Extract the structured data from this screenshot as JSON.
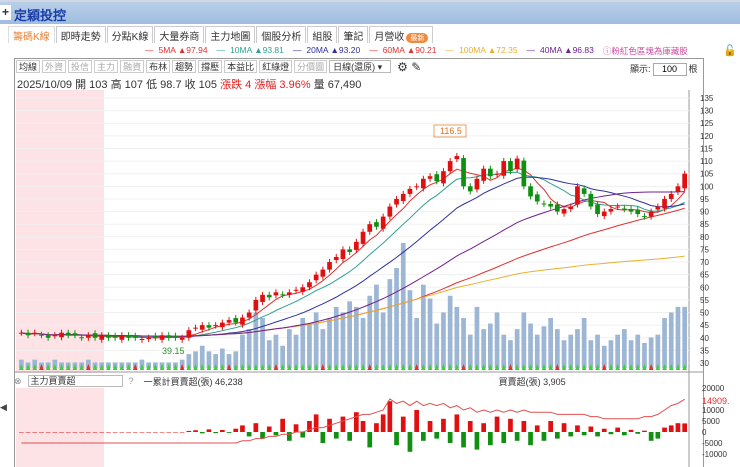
{
  "window": {
    "title": "定穎投控",
    "plus": "+"
  },
  "tabs": [
    {
      "label": "籌碼K線",
      "active": true
    },
    {
      "label": "即時走勢"
    },
    {
      "label": "分點K線"
    },
    {
      "label": "大量券商"
    },
    {
      "label": "主力地圖"
    },
    {
      "label": "個股分析"
    },
    {
      "label": "組股"
    },
    {
      "label": "筆記"
    },
    {
      "label": "月營收",
      "badge": "最新"
    }
  ],
  "legend": [
    {
      "label": "5MA",
      "value": "▲97.94",
      "color": "#e03030"
    },
    {
      "label": "10MA",
      "value": "▲93.81",
      "color": "#30a090"
    },
    {
      "label": "20MA",
      "value": "▲93.20",
      "color": "#3030a0"
    },
    {
      "label": "60MA",
      "value": "▲90.21",
      "color": "#e03030"
    },
    {
      "label": "100MA",
      "value": "▲72.35",
      "color": "#e8b030"
    },
    {
      "label": "40MA",
      "value": "▲96.83",
      "color": "#702090"
    }
  ],
  "legend_note": "ⓘ粉紅色區塊為庫藏股",
  "toolbar": [
    {
      "label": "均線"
    },
    {
      "label": "外資",
      "disabled": true
    },
    {
      "label": "投信",
      "disabled": true
    },
    {
      "label": "主力",
      "disabled": true
    },
    {
      "label": "融資",
      "disabled": true
    },
    {
      "label": "布林"
    },
    {
      "label": "趨勢"
    },
    {
      "label": "撐壓"
    },
    {
      "label": "本益比"
    },
    {
      "label": "紅綠燈"
    },
    {
      "label": "分價圖",
      "disabled": true
    }
  ],
  "period_select": "日線(還原)",
  "display": {
    "label": "顯示:",
    "value": "100",
    "unit": "根"
  },
  "info": {
    "date": "2025/10/09",
    "open": "開 103",
    "high": "高 107",
    "low": "低 98.7",
    "close": "收 105",
    "change": "漲跌 4",
    "pct": "漲幅 3.96%",
    "volume": "量 67,490"
  },
  "chart_data": {
    "type": "candlestick",
    "price_ticks": [
      135,
      130,
      125,
      120,
      115,
      110,
      105,
      100,
      95,
      90,
      85,
      80,
      75,
      70,
      65,
      60,
      55,
      50,
      45,
      40,
      35,
      30
    ],
    "ylim": [
      30,
      135
    ],
    "annotations": {
      "high": "116.5",
      "low": "39.15"
    },
    "closes": [
      42,
      41,
      42,
      41,
      40,
      41,
      42,
      41,
      41,
      40,
      41,
      40,
      41,
      40,
      40,
      41,
      40,
      40,
      39.5,
      40,
      40,
      41,
      40,
      40,
      40,
      43,
      44,
      45,
      44,
      45,
      46,
      47,
      46,
      48,
      50,
      55,
      57,
      56,
      58,
      57,
      58,
      59,
      60,
      62,
      65,
      67,
      70,
      72,
      75,
      74,
      78,
      82,
      85,
      84,
      88,
      92,
      95,
      97,
      99,
      100,
      103,
      104,
      102,
      106,
      110,
      112,
      100,
      98,
      103,
      107,
      104,
      105,
      110,
      106,
      111,
      100,
      96,
      94,
      93,
      92,
      90,
      91,
      92,
      100,
      97,
      92,
      89,
      90,
      91,
      92,
      91,
      90,
      89,
      88,
      90,
      92,
      95,
      97,
      100,
      105
    ],
    "volumes": [
      3,
      2,
      3,
      2,
      2,
      3,
      2,
      2,
      2,
      2,
      3,
      2,
      2,
      2,
      2,
      2,
      2,
      2,
      3,
      2,
      2,
      2,
      2,
      2,
      3,
      5,
      6,
      8,
      6,
      5,
      7,
      5,
      6,
      12,
      14,
      20,
      18,
      10,
      12,
      8,
      14,
      12,
      18,
      16,
      20,
      14,
      18,
      22,
      20,
      24,
      22,
      18,
      26,
      30,
      20,
      32,
      36,
      45,
      28,
      18,
      30,
      25,
      16,
      20,
      26,
      22,
      18,
      12,
      22,
      14,
      16,
      20,
      12,
      10,
      14,
      20,
      16,
      12,
      15,
      18,
      14,
      10,
      12,
      14,
      18,
      10,
      12,
      8,
      10,
      12,
      14,
      10,
      12,
      9,
      11,
      12,
      18,
      20,
      22,
      22
    ],
    "indicator": {
      "name": "主力買賣超",
      "cumulative_label": "一累計買賣超(張) 46,238",
      "daily_label": "買賣超(張) 3,905",
      "last_value": "14909.",
      "ticks": [
        20000,
        10000,
        5000,
        0,
        -5000,
        -10000
      ],
      "values": [
        0,
        0,
        0,
        0,
        0,
        0,
        0,
        0,
        0,
        0,
        0,
        0,
        0,
        0,
        0,
        0,
        0,
        0,
        0,
        0,
        0,
        0,
        0,
        0,
        0,
        500,
        800,
        -600,
        1200,
        -500,
        900,
        -400,
        1500,
        3000,
        -2000,
        4000,
        -3000,
        2500,
        -1500,
        6000,
        -4000,
        3500,
        -2500,
        5000,
        8000,
        -5000,
        6000,
        -3000,
        7000,
        -4000,
        9000,
        5000,
        -7000,
        4000,
        8000,
        14000,
        -6000,
        7000,
        -9000,
        10000,
        -4000,
        5000,
        -3000,
        6000,
        -5000,
        8000,
        -7000,
        5000,
        -8000,
        4000,
        -6000,
        7000,
        -5000,
        6000,
        -4000,
        5000,
        -6000,
        3000,
        -4000,
        5000,
        -3000,
        4000,
        -2000,
        3000,
        -1500,
        2500,
        -2000,
        1500,
        -1000,
        2000,
        -1500,
        1000,
        -800,
        600,
        -4000,
        -3000,
        2000,
        3000,
        4000,
        3905
      ],
      "cum_line": [
        -5000,
        -5000,
        -5000,
        -5000,
        -5000,
        -5000,
        -5000,
        -5000,
        -5000,
        -5000,
        -5000,
        -5000,
        -5000,
        -5000,
        -5000,
        -5000,
        -5000,
        -5000,
        -5000,
        -5000,
        -5000,
        -5000,
        -5000,
        -5000,
        -5000,
        -5000,
        -5000,
        -5000,
        -5000,
        -5000,
        -5000,
        -5000,
        -5000,
        -4000,
        -4000,
        -3000,
        -3000,
        -2000,
        -2000,
        -1000,
        -1000,
        0,
        0,
        1000,
        2000,
        2000,
        3000,
        4000,
        5000,
        6000,
        7000,
        8000,
        8000,
        9000,
        10000,
        15000,
        13000,
        14000,
        12000,
        14000,
        12000,
        13000,
        12000,
        13000,
        11000,
        12000,
        10000,
        11000,
        9000,
        10000,
        9000,
        10000,
        9000,
        10000,
        9000,
        10000,
        9000,
        9000,
        9000,
        9000,
        8000,
        8000,
        8000,
        8000,
        8000,
        7000,
        7000,
        6000,
        6000,
        6000,
        6000,
        6000,
        6000,
        7000,
        7000,
        8000,
        10000,
        12000,
        13000,
        14909
      ]
    }
  }
}
